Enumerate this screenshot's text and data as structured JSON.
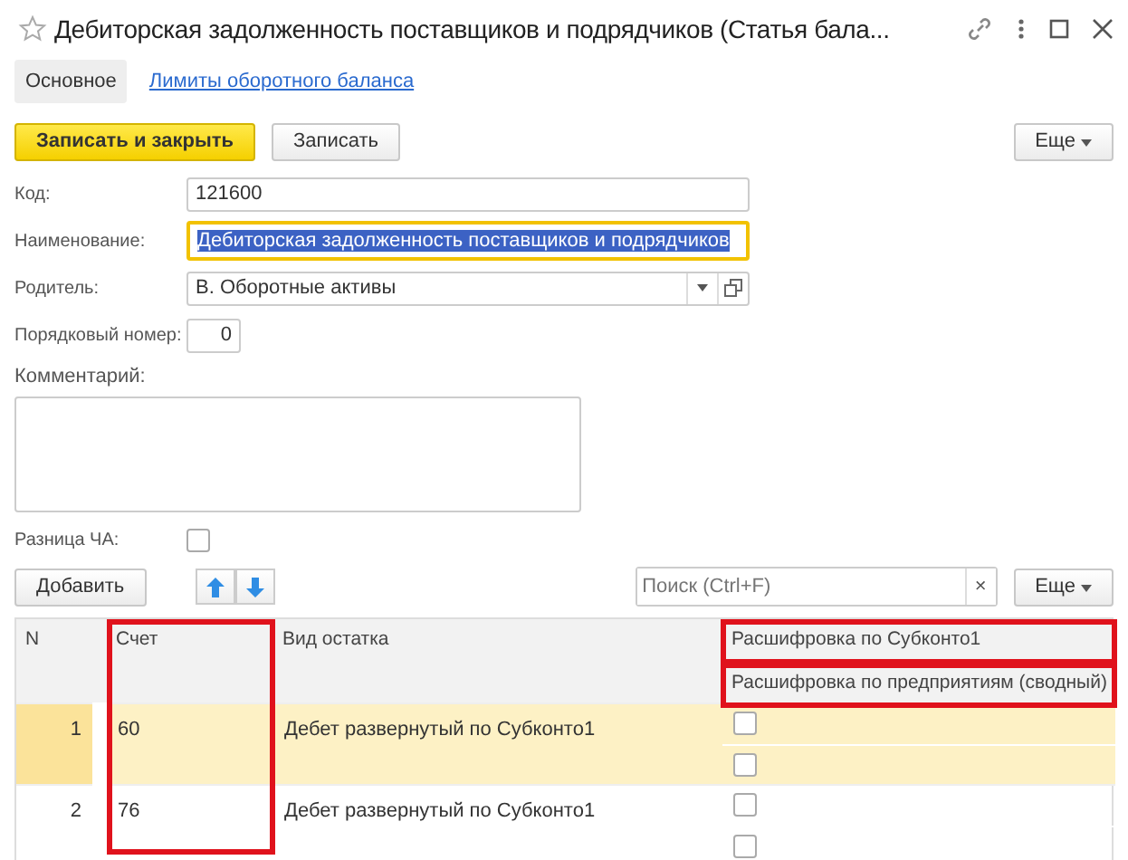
{
  "window": {
    "title": "Дебиторская задолженность поставщиков и подрядчиков (Статья  бала...",
    "favorite": false
  },
  "tabs": [
    {
      "label": "Основное",
      "selected": true
    },
    {
      "label": "Лимиты оборотного баланса",
      "selected": false
    }
  ],
  "toolbar": {
    "primary": "Записать и закрыть",
    "secondary": "Записать",
    "more": "Еще"
  },
  "fields": {
    "code": {
      "label": "Код:",
      "value": "121600"
    },
    "name": {
      "label": "Наименование:",
      "value": "Дебиторская задолженность поставщиков и подрядчиков"
    },
    "parent": {
      "label": "Родитель:",
      "value": "В. Оборотные активы"
    },
    "order": {
      "label": "Порядковый номер:",
      "value": "0"
    },
    "comment": {
      "label": "Комментарий:"
    },
    "diff": {
      "label": "Разница ЧА:",
      "checked": false
    }
  },
  "table_toolbar": {
    "add": "Добавить",
    "search": {
      "placeholder": "Поиск (Ctrl+F)"
    },
    "clear": "×",
    "more": "Еще"
  },
  "table": {
    "columns": [
      "N",
      "Счет",
      "Вид остатка"
    ],
    "group_column": {
      "top": "Расшифровка по Субконто1",
      "bottom": "Расшифровка по предприятиям (сводный)"
    },
    "rows": [
      {
        "n": "1",
        "account": "60",
        "kind": "Дебет развернутый по Субконто1",
        "sub1": false,
        "summary": false,
        "selected": true
      },
      {
        "n": "2",
        "account": "76",
        "kind": "Дебет развернутый по Субконто1",
        "sub1": false,
        "summary": false,
        "selected": false
      }
    ]
  }
}
